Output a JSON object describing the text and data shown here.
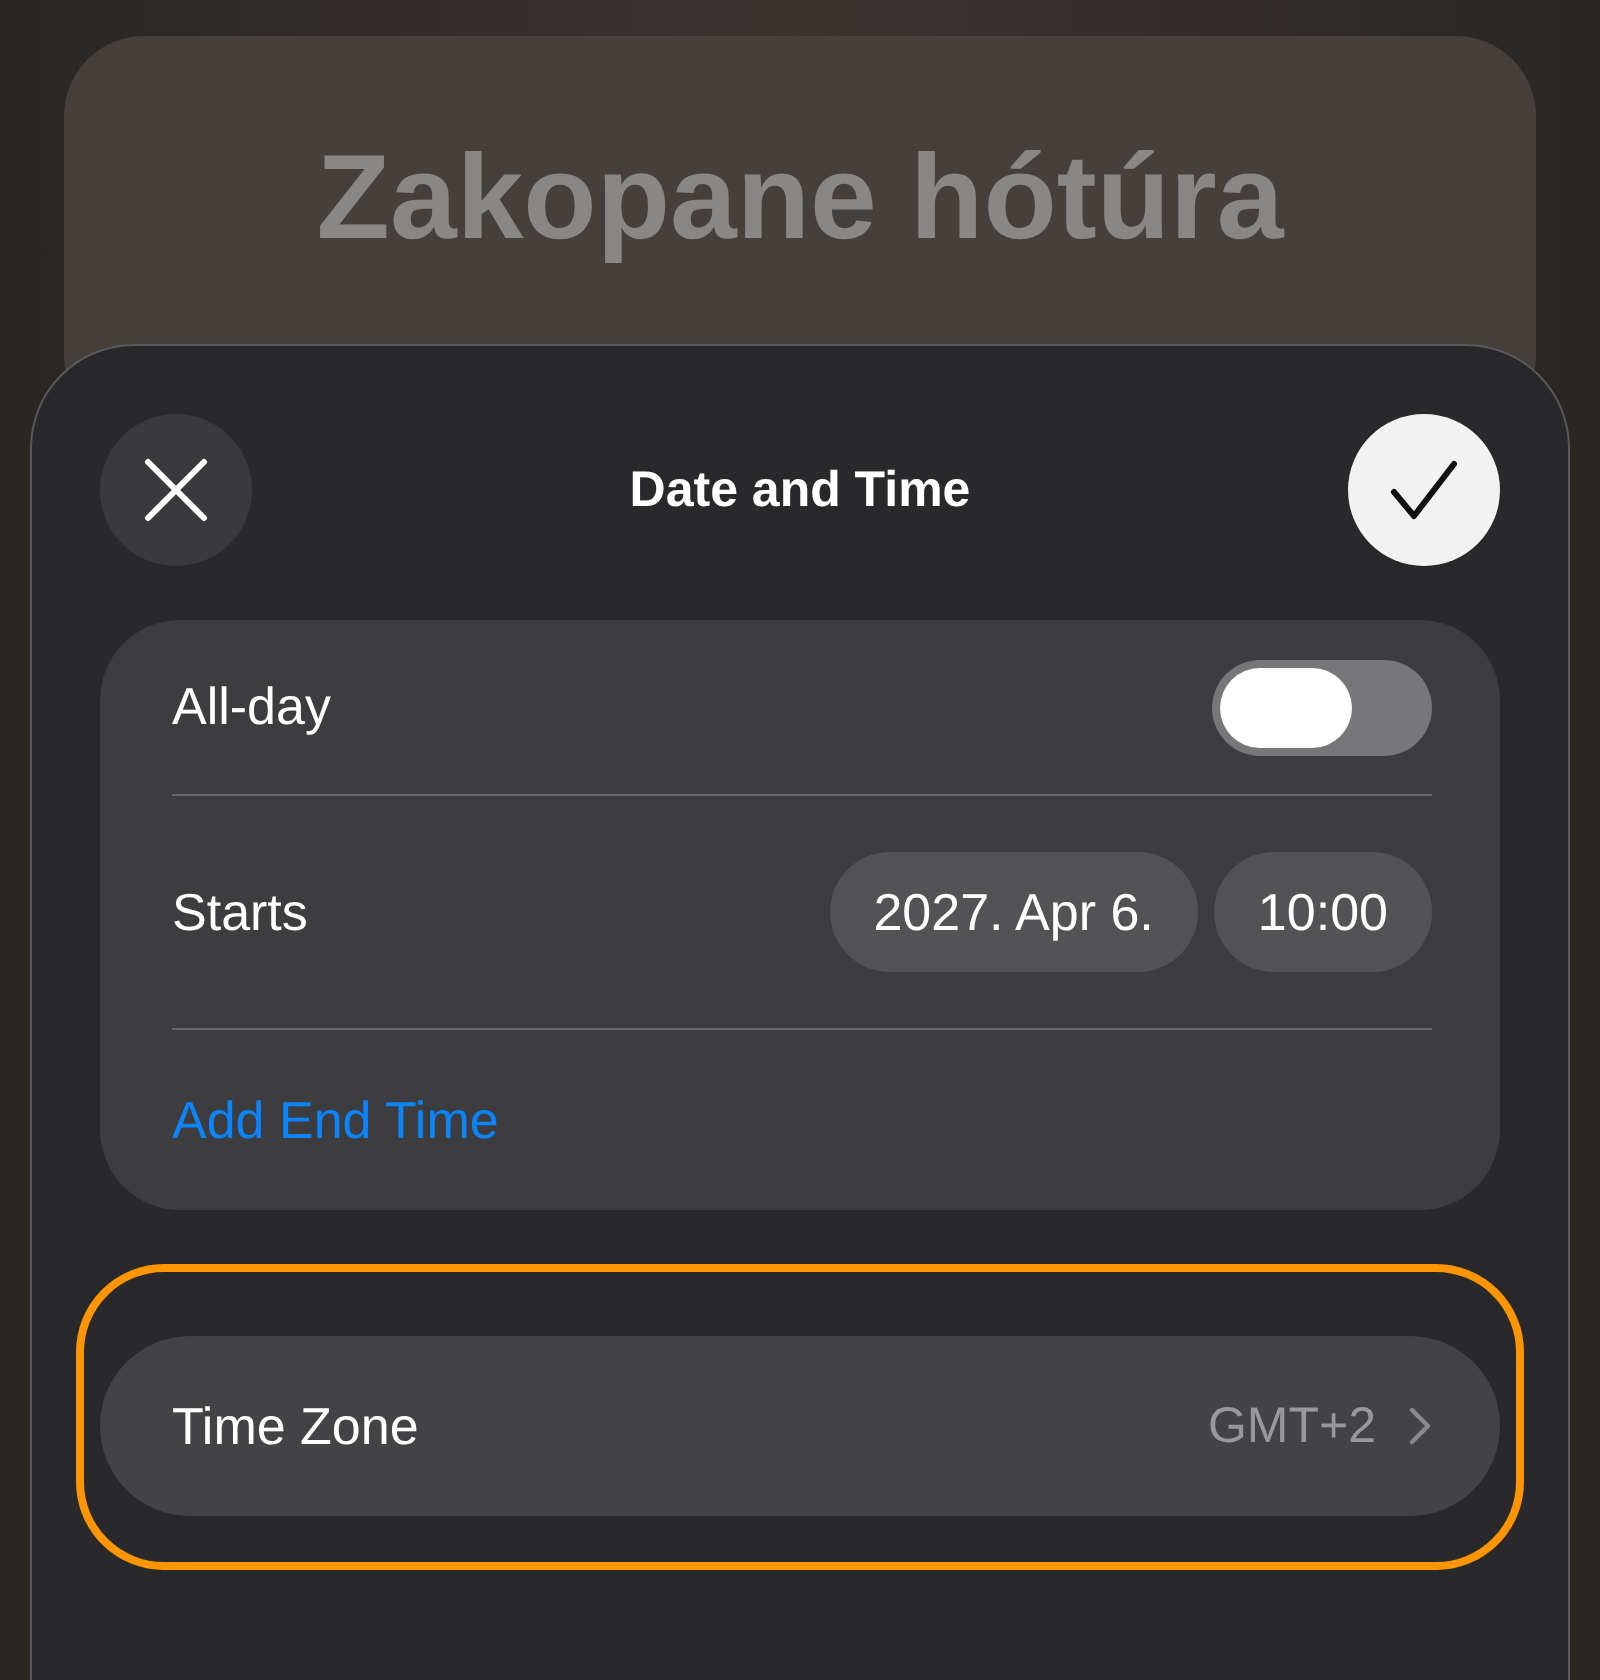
{
  "background_card": {
    "title": "Zakopane hótúra"
  },
  "sheet": {
    "title": "Date and Time"
  },
  "all_day": {
    "label": "All-day",
    "on": false
  },
  "starts": {
    "label": "Starts",
    "date": "2027. Apr 6.",
    "time": "10:00"
  },
  "add_end_time": "Add End Time",
  "time_zone": {
    "label": "Time Zone",
    "value": "GMT+2",
    "highlighted": true
  }
}
